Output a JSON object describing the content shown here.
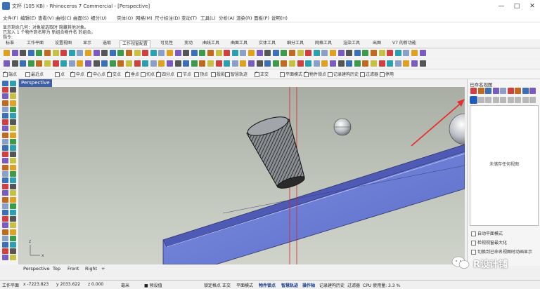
{
  "window": {
    "title": "文杯 (105 KB) - Rhinoceros 7 Commercial - [Perspective]",
    "controls": [
      "—",
      "□",
      "✕"
    ]
  },
  "menu": {
    "items": [
      "文件(F)",
      "编辑(E)",
      "查看(V)",
      "曲线(C)",
      "曲面(S)",
      "细分(U)",
      "实体(O)",
      "网格(M)",
      "尺寸标注(D)",
      "变动(T)",
      "工具(L)",
      "分析(A)",
      "渲染(R)",
      "面板(P)",
      "说明(H)"
    ]
  },
  "command_history": {
    "line1": "显示剩余几何：对象被选取时 隐藏其他对象。",
    "line2": "已加入 1 个物件到名称为 新组合物件名 的组合。",
    "prompt": "指令:"
  },
  "tabs": {
    "items": [
      "标准",
      "工作平面",
      "设置视图",
      "显示",
      "选取",
      "工作视窗配置",
      "可见性",
      "变动",
      "曲线工具",
      "曲面工具",
      "实体工具",
      "细分工具",
      "网格工具",
      "渲染工具",
      "出图",
      "V7 的新功能"
    ],
    "active_index": 5
  },
  "osnap": {
    "items": [
      {
        "label": "端点",
        "checked": true
      },
      {
        "label": "最近点",
        "checked": false
      },
      {
        "label": "点",
        "checked": false
      },
      {
        "label": "中点",
        "checked": true
      },
      {
        "label": "中心点",
        "checked": true
      },
      {
        "label": "交点",
        "checked": true
      },
      {
        "label": "垂点",
        "checked": true
      },
      {
        "label": "切点",
        "checked": false
      },
      {
        "label": "四分点",
        "checked": true
      },
      {
        "label": "节点",
        "checked": false
      },
      {
        "label": "顶点",
        "checked": false
      },
      {
        "label": "投影",
        "checked": false
      },
      {
        "label": "智慧轨迹",
        "checked": false
      },
      {
        "label": "正交",
        "checked": true
      },
      {
        "label": "平面模式",
        "checked": false
      },
      {
        "label": "物件锁点",
        "checked": true
      },
      {
        "label": "记录建构历史",
        "checked": false
      },
      {
        "label": "过滤器",
        "checked": false
      },
      {
        "label": "停用",
        "checked": false
      }
    ]
  },
  "viewport": {
    "active_label": "Perspective",
    "axis_label_z": "z",
    "axis_label_x": "x",
    "bottom_tabs": [
      "Perspective",
      "Top",
      "Front",
      "Right",
      "+"
    ]
  },
  "layer_panel": {
    "title": "已命名视图",
    "empty_text": "未储存任何视图",
    "options": [
      {
        "label": "自动平面模式",
        "checked": false
      },
      {
        "label": "检视视窗最大化",
        "checked": false
      },
      {
        "label": "切换到已命名视图时动画显示",
        "checked": false
      }
    ]
  },
  "status_bar": {
    "cplane": "工作平面",
    "x": "x -7223.823",
    "y": "y 2033.622",
    "z": "z 0.000",
    "units": "毫米",
    "layer": "■ 预设值",
    "toggles": [
      "锁定格点",
      "正交",
      "平面模式",
      "物件锁点",
      "智慧轨迹",
      "操作轴",
      "记录建构历史",
      "过滤器"
    ],
    "cpu": "CPU 使用量: 3.3 %"
  },
  "watermark": {
    "text": "R设计铺"
  },
  "colors": {
    "viewport_tab": "#3f5fa5",
    "plane_fill": "#6d7fd8",
    "red_arrow": "#e53030",
    "panel_highlight": "#1f5cbf"
  },
  "icons": {
    "toolbar": "rhino-command-icons",
    "layer_panel": "named-view-icons"
  }
}
